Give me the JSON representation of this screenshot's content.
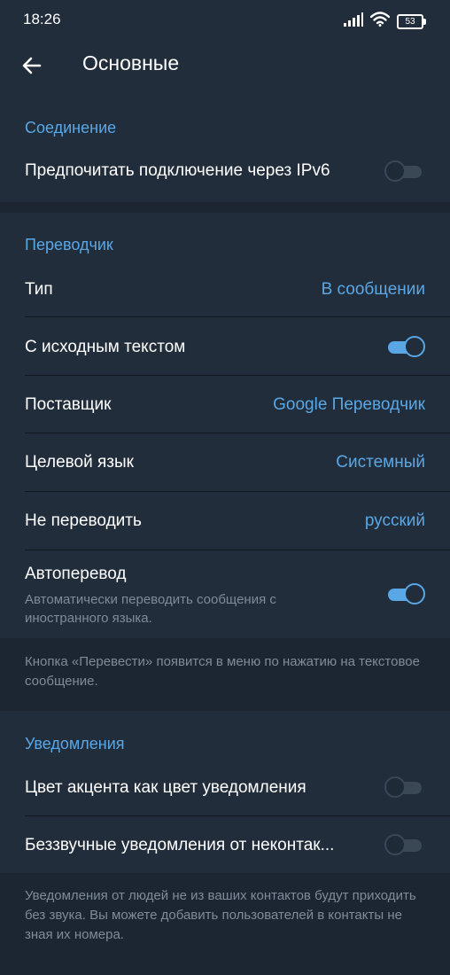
{
  "status_bar": {
    "time": "18:26",
    "battery": "53",
    "icons": [
      "signal-icon",
      "wifi-icon",
      "battery-icon"
    ]
  },
  "header": {
    "title": "Основные",
    "back_icon": "arrow-left-icon"
  },
  "colors": {
    "background": "#1c2633",
    "panel": "#212d3b",
    "accent": "#5aa7e6",
    "muted": "#7f8b98"
  },
  "connection": {
    "title": "Соединение",
    "ipv6_label": "Предпочитать подключение через IPv6",
    "ipv6_enabled": false
  },
  "translator": {
    "title": "Переводчик",
    "type_label": "Тип",
    "type_value": "В сообщении",
    "with_source_label": "С исходным текстом",
    "with_source_enabled": true,
    "provider_label": "Поставщик",
    "provider_value": "Google Переводчик",
    "target_label": "Целевой язык",
    "target_value": "Системный",
    "dont_translate_label": "Не переводить",
    "dont_translate_value": "русский",
    "auto_label": "Автоперевод",
    "auto_sub": "Автоматически переводить сообщения с иностранного языка.",
    "auto_enabled": true,
    "info": "Кнопка «Перевести» появится в меню по нажатию на текстовое сообщение."
  },
  "notifications": {
    "title": "Уведомления",
    "accent_label": "Цвет акцента как цвет уведомления",
    "accent_enabled": false,
    "silent_label": "Беззвучные уведомления от неконтак...",
    "silent_enabled": false,
    "info": "Уведомления от людей не из ваших контактов будут приходить без звука. Вы можете добавить пользователей в контакты не зная их номера."
  }
}
